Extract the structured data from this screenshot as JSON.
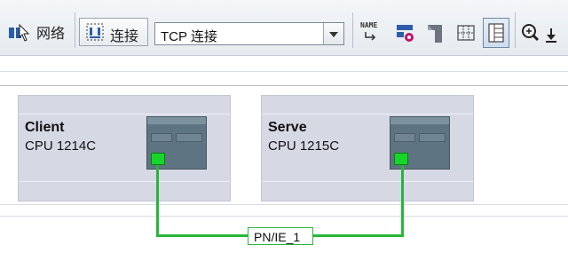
{
  "toolbar": {
    "network_label": "网络",
    "connect_label": "连接",
    "connection_type": "TCP 连接",
    "name_icon_text": "NAME"
  },
  "devices": [
    {
      "name": "Client",
      "type": "CPU 1214C"
    },
    {
      "name": "Serve",
      "type": "CPU 1215C"
    }
  ],
  "subnet": {
    "label": "PN/IE_1",
    "color": "#27b63a"
  },
  "colors": {
    "device_bg": "#d6d8e4",
    "port": "#17d52a",
    "plc_body": "#5f7482"
  }
}
